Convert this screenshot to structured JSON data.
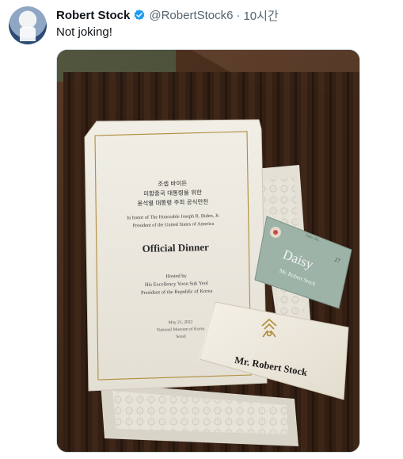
{
  "tweet": {
    "author_name": "Robert Stock",
    "handle": "@RobertStock6",
    "separator": "·",
    "time": "10시간",
    "text": "Not joking!"
  },
  "photo": {
    "menu": {
      "korean_line1": "조셉 바이든",
      "korean_line2": "미합중국 대통령을 위한",
      "korean_line3": "윤석열 대통령 주최 공식만찬",
      "honor_line1": "In honor of The Honorable Joseph R. Biden, Jr.",
      "honor_line2": "President of the United States of America",
      "title": "Official Dinner",
      "hosted": "Hosted by",
      "host_line1": "His Excellency Yoon Suk Yeol",
      "host_line2": "President of the Republic of Korea",
      "date": "May 21, 2022",
      "venue": "National Museum of Korea",
      "city": "Seoul"
    },
    "table_card": {
      "flower": "Daisy",
      "name": "Mr. Robert Stock",
      "number": "27",
      "top_label": "Table No."
    },
    "place_card": {
      "name": "Mr. Robert Stock"
    }
  },
  "colors": {
    "verified": "#1d9bf0",
    "text_primary": "#0f1419",
    "text_secondary": "#536471",
    "table_card_green": "#8aa79a",
    "gold": "#b08d3c"
  }
}
